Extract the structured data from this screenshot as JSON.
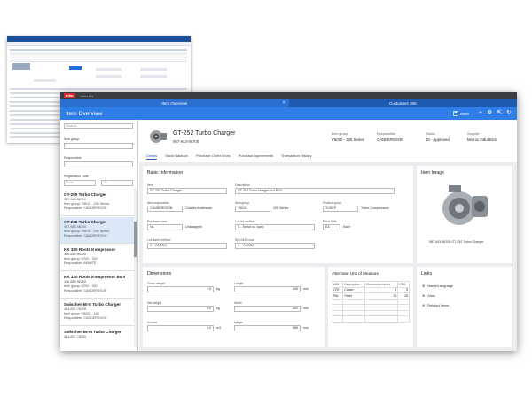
{
  "main": {
    "logo": "Infor",
    "app_tab": "Infor LN",
    "tabs": [
      {
        "label": "Item Overview"
      },
      {
        "label": "Customers 360"
      }
    ],
    "close_glyph": "×",
    "header": {
      "title": "Item Overview",
      "save_label": "Save"
    }
  },
  "left": {
    "search_placeholder": "Search",
    "item_group_label": "Item group",
    "responsible_label": "Responsible",
    "reg_date_label": "Registration Date",
    "from_placeholder": "From",
    "to_label": "To",
    "cards": [
      {
        "name": "GT-200 Turbo Charger",
        "pn": "987-943-98710",
        "group": "Item group: Y5010 - 200 Series",
        "resp": "Responsible: CANDERSSON"
      },
      {
        "name": "GT-252 Turbo Charger",
        "pn": "987-943-98700",
        "group": "Item group: Y5010 - 200 Series",
        "resp": "Responsible: CANDERSSON"
      },
      {
        "name": "KK 300 Roots Kompressor",
        "pn": "456-859-98700",
        "group": "Item group: K200 - 300",
        "resp": "Responsible: AWHITE"
      },
      {
        "name": "KK 320 Roots Kompressor BOV",
        "pn": "456-859-98700",
        "group": "Item group: K200 - 300",
        "resp": "Responsible: CANDERSSON"
      },
      {
        "name": "Swischer 60-E Turbo Charger",
        "pn": "444-827-78200",
        "group": "Item group: Y5020 - 100",
        "resp": "Responsible: CANDERSSON"
      },
      {
        "name": "Swischer 65-M Turbo Charger",
        "pn": "444-827-78200",
        "group": "",
        "resp": ""
      }
    ]
  },
  "summary": {
    "title": "GT-252 Turbo Charger",
    "part_number": "987-943-98700",
    "item_group_label": "Item group",
    "item_group": "Y5010 - 200 Series",
    "responsible_label": "Responsible",
    "responsible": "CANDERSSON",
    "status_label": "Status",
    "status": "20 - Approved",
    "supplier_label": "Supplier",
    "supplier": "Metrox Industries",
    "subtabs": [
      "Details",
      "Stock Balance",
      "Purchase Order Lines",
      "Purchase Agreements",
      "Transaction History"
    ]
  },
  "basic": {
    "title": "Basic Information",
    "item_label": "Item",
    "item": "GT-252 Turbo Charger",
    "desc_label": "Description",
    "desc": "GT-252 Turbo charger incl BOV",
    "resp_label": "Item responsible",
    "resp": "CANDERSSON",
    "resp_name": "Charles Andersson",
    "group_label": "Item group",
    "group": "Y5010",
    "group_name": "200 Series",
    "prod_group_label": "Product group",
    "prod_group": "TUSKP",
    "prod_group_name": "Turbo Compressors",
    "ptype_label": "Purchase view",
    "ptype": "VA",
    "ptype_name": "Unassigned",
    "lot_label": "Lot ctrl method",
    "lot": "S - Serial no. spec",
    "uom_label": "Basic U/M",
    "uom": "EA",
    "uom_name": "Each",
    "lotnum_label": "Lot numb method",
    "lotnum": "X - YOOOO",
    "sn_label": "SN U/M in use",
    "sn": "X - YOOOO"
  },
  "dimensions": {
    "title": "Dimensions",
    "gross_label": "Gross weight",
    "gross": "7,5",
    "gross_unit": "kg",
    "length_label": "Length",
    "length": "345",
    "length_unit": "mm",
    "net_label": "Net weight",
    "net": "8,0",
    "net_unit": "kg",
    "width_label": "Width",
    "width": "400",
    "width_unit": "mm",
    "volume_label": "Volume",
    "volume": "5,0",
    "volume_unit": "m3",
    "height_label": "Height",
    "height": "385",
    "height_unit": "mm"
  },
  "uom": {
    "title": "Alternate Unit of Measure",
    "headers": [
      "U/M",
      "Description",
      "Conversion factor",
      "CRA"
    ],
    "rows": [
      [
        "CRT",
        "Carton",
        "5",
        "5"
      ],
      [
        "PAL",
        "Pallet",
        "25",
        "25"
      ]
    ]
  },
  "image": {
    "title": "Item Image",
    "caption": "987-943-98700 GT-252 Turbo Charger"
  },
  "links": {
    "title": "Links",
    "items": [
      "Name/Language",
      "Alias",
      "Related Items"
    ]
  },
  "colors": {
    "accent": "#2f7ee8",
    "tabbar": "#1d5bb3",
    "brand_red": "#d8262c"
  }
}
